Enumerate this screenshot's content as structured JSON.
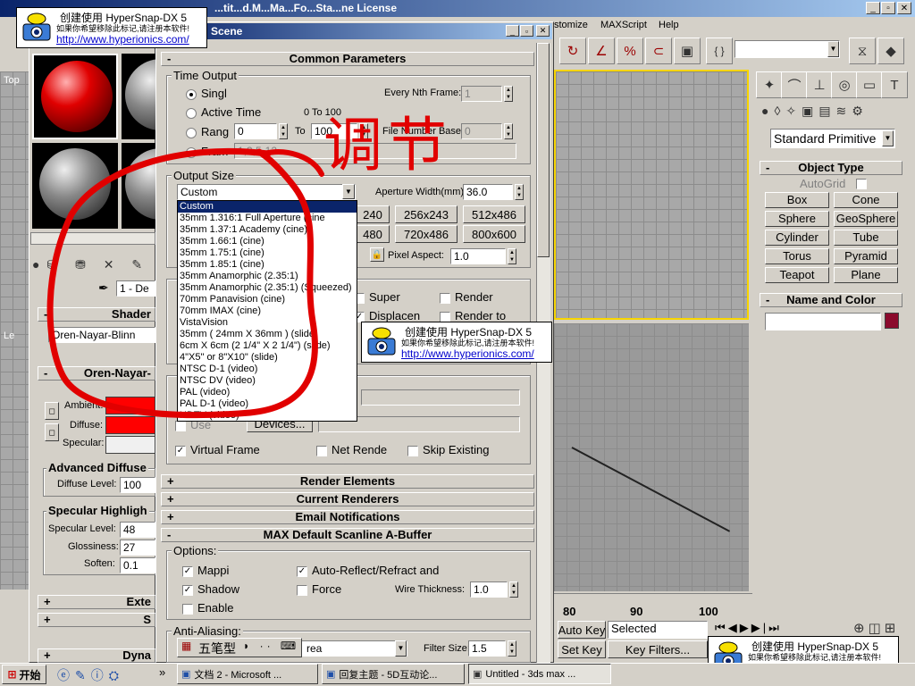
{
  "app": {
    "title_fragment": "...tit...d.M...Ma...Fo...Sta...ne License",
    "menu_right": [
      "stomize",
      "MAXScript",
      "Help"
    ],
    "selection_set_value": "",
    "window_controls": [
      "_",
      "□",
      "x"
    ]
  },
  "render_dialog": {
    "title": "Scene",
    "common_params_header": "Common Parameters",
    "time_output": {
      "label": "Time Output",
      "single": "Singl",
      "every_nth_label": "Every Nth Frame:",
      "every_nth_value": "1",
      "active_time": "Active Time",
      "active_range": "0 To 100",
      "range": "Rang",
      "range_from": "0",
      "range_to_label": "To",
      "range_to": "100",
      "file_number_base_label": "File Number Base:",
      "file_number_base": "0",
      "frames": "Fram",
      "frames_value": "1,3,5-12"
    },
    "output_size": {
      "label": "Output Size",
      "preset_value": "Custom",
      "aperture_label": "Aperture Width(mm):",
      "aperture_value": "36.0",
      "presets": [
        "240",
        "256x243",
        "512x486",
        "480",
        "720x486",
        "800x600"
      ],
      "pixel_aspect_label": "Pixel Aspect:",
      "pixel_aspect_value": "1.0",
      "dropdown_options": [
        "Custom",
        "35mm 1.316:1 Full Aperture (cine",
        "35mm 1.37:1 Academy (cine)",
        "35mm 1.66:1 (cine)",
        "35mm 1.75:1 (cine)",
        "35mm 1.85:1 (cine)",
        "35mm Anamorphic (2.35:1)",
        "35mm Anamorphic (2.35:1) (Squeezed)",
        "70mm Panavision (cine)",
        "70mm IMAX (cine)",
        "VistaVision",
        "35mm ( 24mm X 36mm ) (slide)",
        "6cm X 6cm (2 1/4\" X 2 1/4\") (slide)",
        "4\"X5\" or 8\"X10\" (slide)",
        "NTSC D-1 (video)",
        "NTSC DV (video)",
        "PAL (video)",
        "PAL D-1 (video)",
        "HDTV (video)"
      ]
    },
    "options": {
      "super": "Super",
      "render": "Render",
      "displacement": "Displacen",
      "render_to": "Render to"
    },
    "render_output": {
      "use": "Use",
      "devices": "Devices...",
      "virtual_frame": "Virtual Frame",
      "net_render": "Net Rende",
      "skip_existing": "Skip Existing"
    },
    "rollouts": [
      "Render Elements",
      "Current Renderers",
      "Email Notifications",
      "MAX Default Scanline A-Buffer"
    ],
    "scanline": {
      "options_label": "Options:",
      "mapping": "Mappi",
      "auto_reflect": "Auto-Reflect/Refract and",
      "shadow": "Shadow",
      "force": "Force",
      "wire_thickness_label": "Wire Thickness:",
      "wire_thickness": "1.0",
      "enable": "Enable",
      "anti_aliasing_label": "Anti-Aliasing:",
      "filter_value": "rea",
      "filter_size_label": "Filter Size:",
      "filter_size": "1.5"
    }
  },
  "material_editor": {
    "shader_header": "Shader",
    "shader_value": "Oren-Nayar-Blinn",
    "oren_header": "Oren-Nayar-",
    "ambient": "Ambient:",
    "diffuse": "Diffuse:",
    "specular": "Specular:",
    "adv_diffuse_label": "Advanced Diffuse",
    "diffuse_level_label": "Diffuse Level:",
    "diffuse_level": "100",
    "spec_highlight_label": "Specular Highligh",
    "specular_level_label": "Specular Level:",
    "specular_level": "48",
    "glossiness_label": "Glossiness:",
    "glossiness": "27",
    "soften_label": "Soften:",
    "soften": "0.1",
    "material_name": "1 - De",
    "ext_header": "Exte",
    "s_header": "S",
    "dyn_header": "Dyna",
    "ambient_color": "#ff0000",
    "diffuse_color": "#ff0000"
  },
  "command_panel": {
    "category_value": "Standard Primitive",
    "object_type_header": "Object Type",
    "autogrid": "AutoGrid",
    "buttons": [
      "Box",
      "Cone",
      "Sphere",
      "GeoSphere",
      "Cylinder",
      "Tube",
      "Torus",
      "Pyramid",
      "Teapot",
      "Plane"
    ],
    "name_color_header": "Name and Color",
    "object_color": "#8b0a2c"
  },
  "viewports": {
    "top_label": "Top",
    "left_label": "Le"
  },
  "timeline": {
    "ticks": [
      "80",
      "90",
      "100"
    ],
    "auto_key": "Auto Key",
    "selected": "Selected",
    "set_key": "Set Key",
    "key_filters": "Key Filters..."
  },
  "ime_bar": {
    "label": "五笔型"
  },
  "taskbar": {
    "start": "开始",
    "items": [
      "文档 2 - Microsoft ...",
      "回复主题 - 5D互动论...",
      "Untitled - 3ds max ..."
    ],
    "more": "»"
  },
  "watermark": {
    "title": "创建使用 HyperSnap-DX 5",
    "line2": "如果你希望移除此标记,请注册本软件!",
    "url": "http://www.hyperionics.com/"
  },
  "annotation": {
    "handwritten": "调节"
  }
}
